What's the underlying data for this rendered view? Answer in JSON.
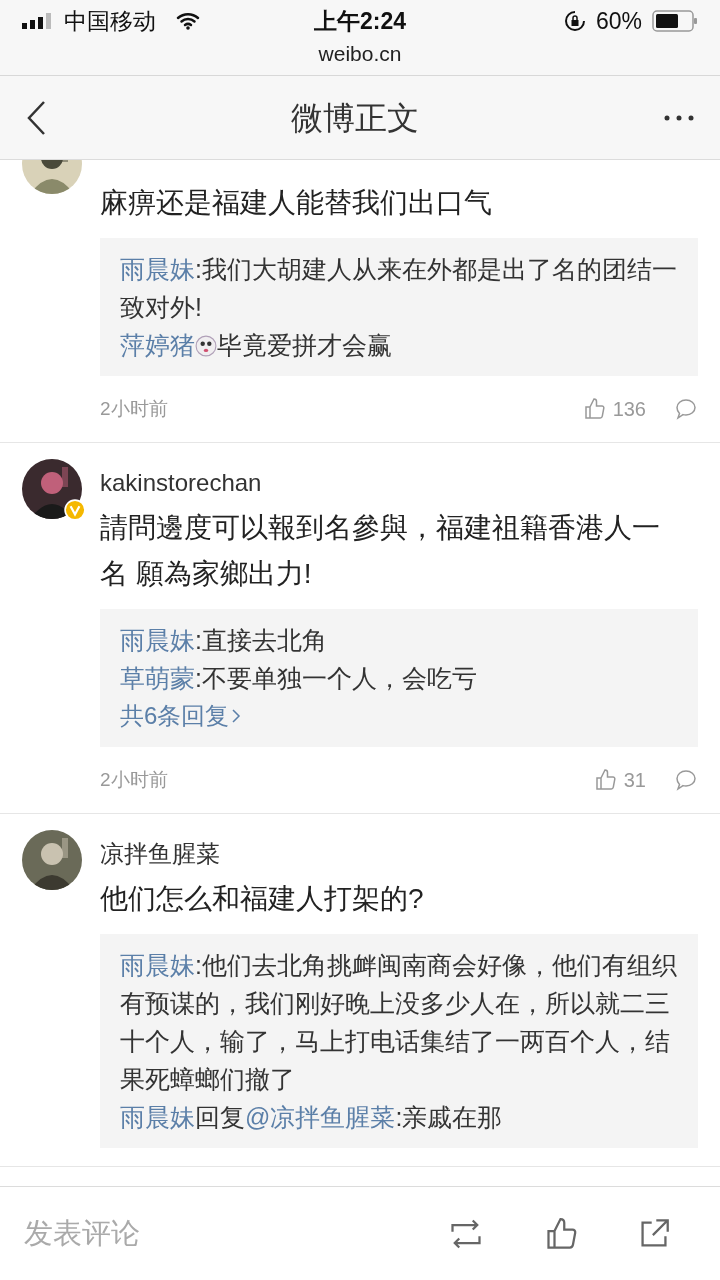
{
  "status_bar": {
    "carrier": "中国移动",
    "time": "上午2:24",
    "battery": "60%",
    "url": "weibo.cn"
  },
  "header": {
    "title": "微博正文"
  },
  "comments": [
    {
      "text": "麻痹还是福建人能替我们出口气",
      "verified": false,
      "replies": [
        {
          "user": "雨晨妹",
          "text": ":我们大胡建人从来在外都是出了名的团结一致对外!",
          "emoji": false
        },
        {
          "user": "萍婷猪",
          "text": "毕竟爱拼才会赢",
          "emoji": true
        }
      ],
      "time": "2小时前",
      "likes": "136"
    },
    {
      "user": "kakinstorechan",
      "verified": true,
      "text": "請問邊度可以報到名參與，福建祖籍香港人一名 願為家鄉出力!",
      "replies": [
        {
          "user": "雨晨妹",
          "text": ":直接去北角",
          "emoji": false
        },
        {
          "user": "草萌蒙",
          "text": ":不要单独一个人，会吃亏",
          "emoji": false
        }
      ],
      "more": "共6条回复",
      "time": "2小时前",
      "likes": "31"
    },
    {
      "user": "凉拌鱼腥菜",
      "verified": false,
      "text": "他们怎么和福建人打架的?",
      "replies": [
        {
          "user": "雨晨妹",
          "text": ":他们去北角挑衅闽南商会好像，他们有组织有预谋的，我们刚好晚上没多少人在，所以就二三十个人，输了，马上打电话集结了一两百个人，结果死蟑螂们撤了",
          "emoji": false
        },
        {
          "user": "雨晨妹",
          "reply_word": "回复",
          "mention": "@凉拌鱼腥菜",
          "text": ":亲戚在那",
          "emoji": false
        }
      ]
    }
  ],
  "bottom_bar": {
    "placeholder": "发表评论"
  }
}
